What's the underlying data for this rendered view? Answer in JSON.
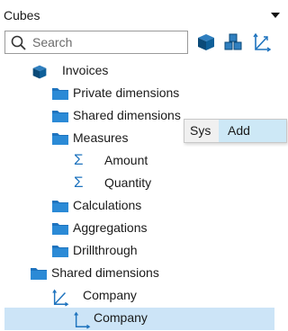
{
  "panel": {
    "title": "Cubes"
  },
  "search": {
    "placeholder": "Search"
  },
  "toolbar": [
    {
      "icon": "cube-icon"
    },
    {
      "icon": "cubes-icon"
    },
    {
      "icon": "axis-icon"
    }
  ],
  "tree": [
    {
      "label": "Invoices",
      "icon": "cube-icon",
      "indent": 1
    },
    {
      "label": "Private dimensions",
      "icon": "folder-icon",
      "indent": 2
    },
    {
      "label": "Shared dimensions",
      "icon": "folder-icon",
      "indent": 2
    },
    {
      "label": "Measures",
      "icon": "folder-icon",
      "indent": 2
    },
    {
      "label": "Amount",
      "icon": "sigma-icon",
      "indent": 3
    },
    {
      "label": "Quantity",
      "icon": "sigma-icon",
      "indent": 3
    },
    {
      "label": "Calculations",
      "icon": "folder-icon",
      "indent": 2
    },
    {
      "label": "Aggregations",
      "icon": "folder-icon",
      "indent": 2
    },
    {
      "label": "Drillthrough",
      "icon": "folder-icon",
      "indent": 2
    },
    {
      "label": "Shared dimensions",
      "icon": "folder-icon",
      "indent": 1
    },
    {
      "label": "Company",
      "icon": "axis-icon",
      "indent": 2
    },
    {
      "label": "Company",
      "icon": "hierarchy-icon",
      "indent": 3,
      "selected": true
    }
  ],
  "context_menu": {
    "sys_label": "Sys",
    "add_label": "Add"
  },
  "colors": {
    "accent": "#1e73be",
    "cube": "#0b4a78",
    "selection": "#cce4f7"
  }
}
